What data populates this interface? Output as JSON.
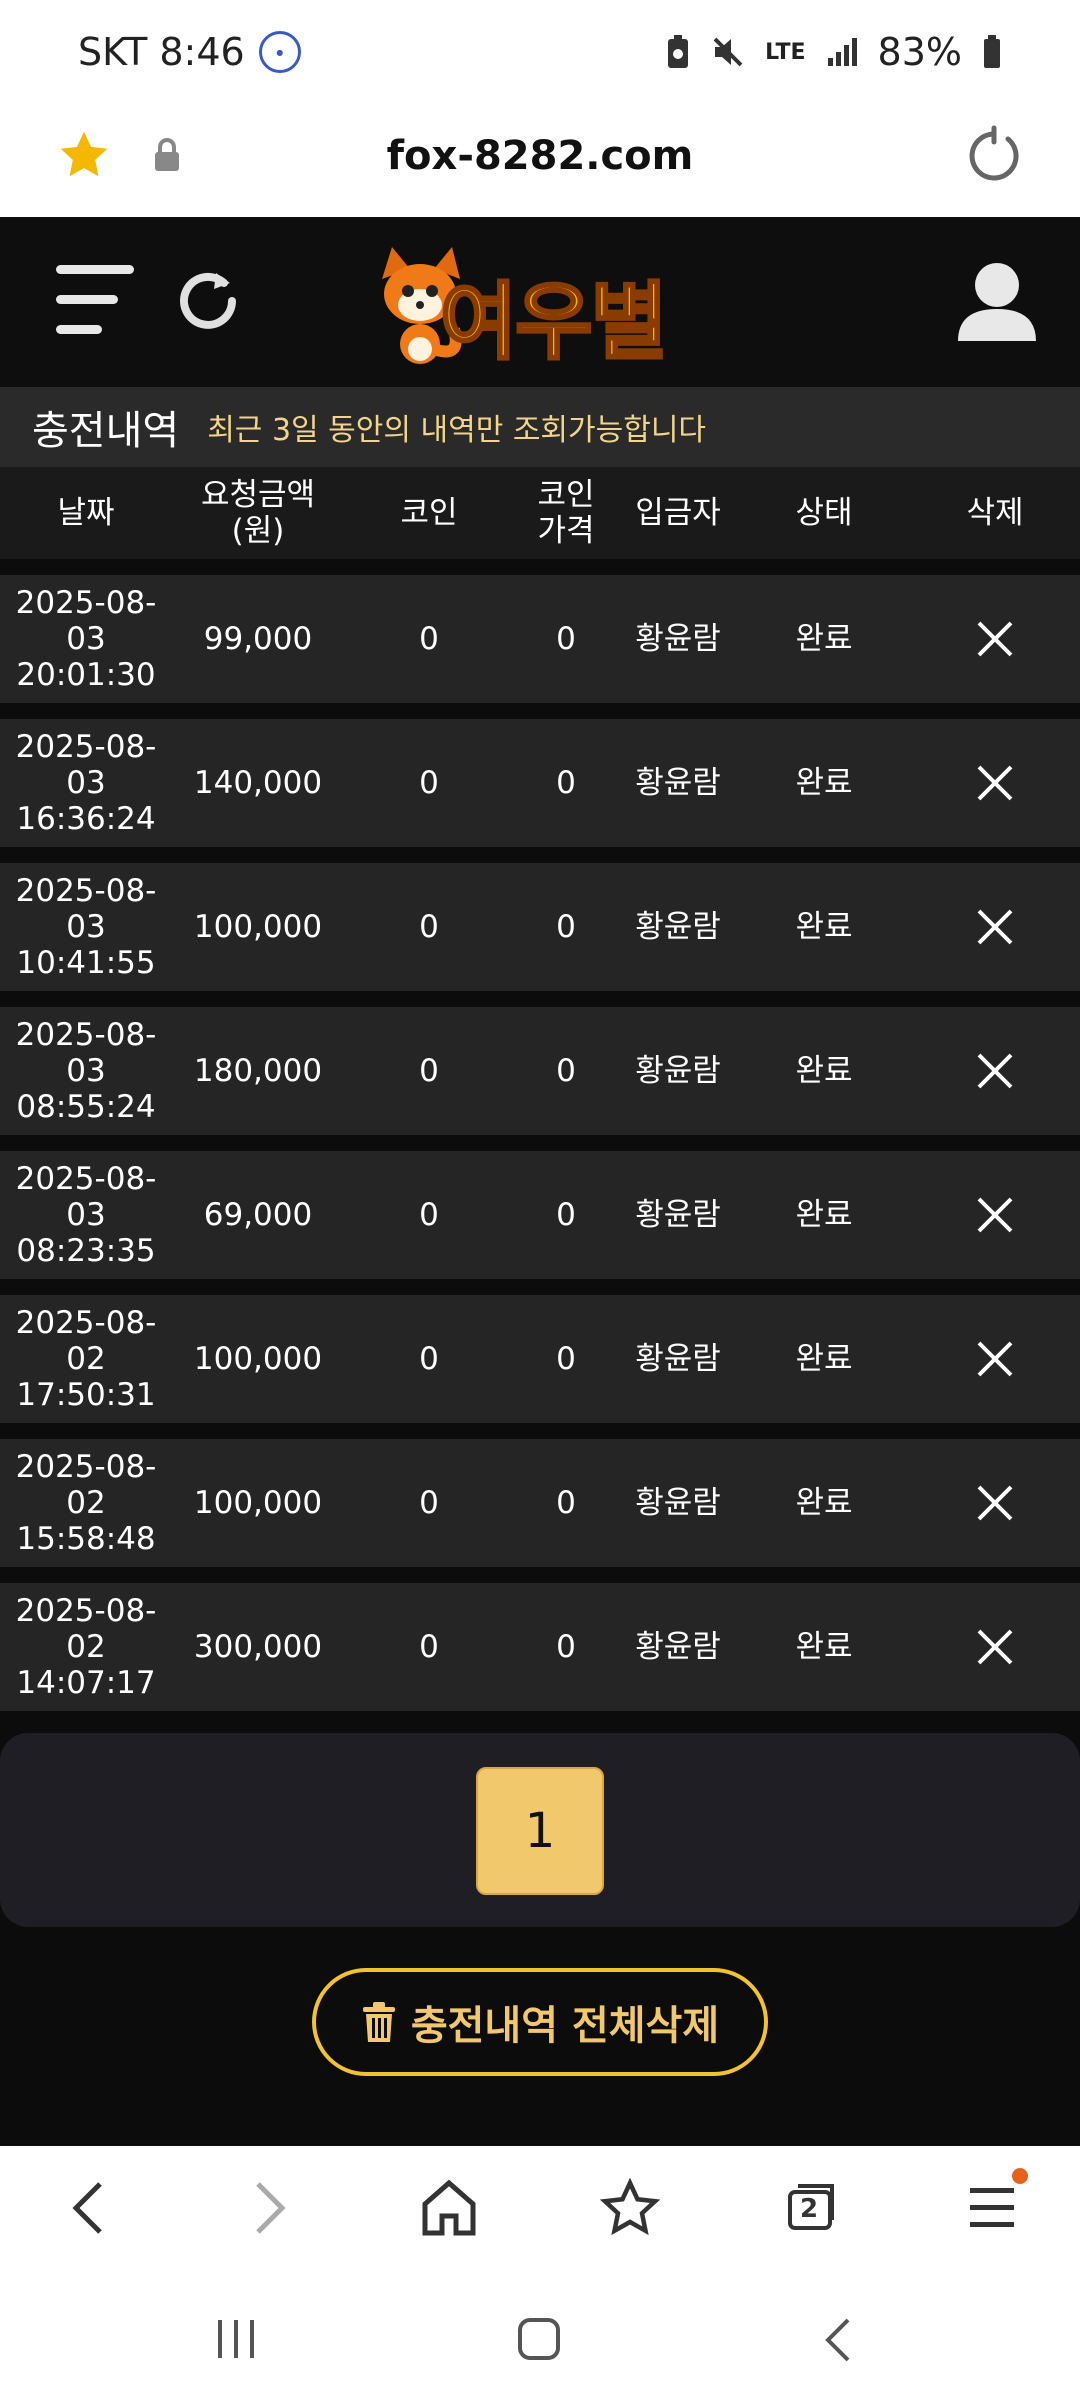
{
  "status_bar": {
    "carrier_time": "SKT 8:46",
    "network": "LTE",
    "battery": "83%"
  },
  "browser": {
    "url": "fox-8282.com"
  },
  "site": {
    "logo_text": "여우별"
  },
  "section": {
    "title": "충전내역",
    "notice": "최근 3일 동안의 내역만 조회가능합니다"
  },
  "table": {
    "headers": {
      "date": "날짜",
      "amount_1": "요청금액",
      "amount_2": "(원)",
      "coin": "코인",
      "coin_price_1": "코인",
      "coin_price_2": "가격",
      "depositor": "입금자",
      "status": "상태",
      "delete": "삭제"
    },
    "rows": [
      {
        "date1": "2025-08-",
        "date2": "03",
        "date3": "20:01:30",
        "amount": "99,000",
        "coin": "0",
        "price": "0",
        "depositor": "황윤람",
        "status": "완료"
      },
      {
        "date1": "2025-08-",
        "date2": "03",
        "date3": "16:36:24",
        "amount": "140,000",
        "coin": "0",
        "price": "0",
        "depositor": "황윤람",
        "status": "완료"
      },
      {
        "date1": "2025-08-",
        "date2": "03",
        "date3": "10:41:55",
        "amount": "100,000",
        "coin": "0",
        "price": "0",
        "depositor": "황윤람",
        "status": "완료"
      },
      {
        "date1": "2025-08-",
        "date2": "03",
        "date3": "08:55:24",
        "amount": "180,000",
        "coin": "0",
        "price": "0",
        "depositor": "황윤람",
        "status": "완료"
      },
      {
        "date1": "2025-08-",
        "date2": "03",
        "date3": "08:23:35",
        "amount": "69,000",
        "coin": "0",
        "price": "0",
        "depositor": "황윤람",
        "status": "완료"
      },
      {
        "date1": "2025-08-",
        "date2": "02",
        "date3": "17:50:31",
        "amount": "100,000",
        "coin": "0",
        "price": "0",
        "depositor": "황윤람",
        "status": "완료"
      },
      {
        "date1": "2025-08-",
        "date2": "02",
        "date3": "15:58:48",
        "amount": "100,000",
        "coin": "0",
        "price": "0",
        "depositor": "황윤람",
        "status": "완료"
      },
      {
        "date1": "2025-08-",
        "date2": "02",
        "date3": "14:07:17",
        "amount": "300,000",
        "coin": "0",
        "price": "0",
        "depositor": "황윤람",
        "status": "완료"
      }
    ]
  },
  "pagination": {
    "current_page": "1"
  },
  "actions": {
    "delete_all_label": "충전내역 전체삭제"
  },
  "browser_toolbar": {
    "tabs_count": "2"
  },
  "colors": {
    "accent": "#f2c86c",
    "notice": "#f3d58a",
    "row_bg": "#252525",
    "page_bg": "#0c0c0c"
  },
  "icons": [
    "star-icon",
    "lock-icon",
    "reload-icon",
    "menu-icon",
    "refresh-icon",
    "user-icon",
    "close-icon",
    "trash-icon",
    "back-icon",
    "forward-icon",
    "home-icon",
    "bookmarks-icon",
    "tabs-icon",
    "browser-menu-icon"
  ]
}
